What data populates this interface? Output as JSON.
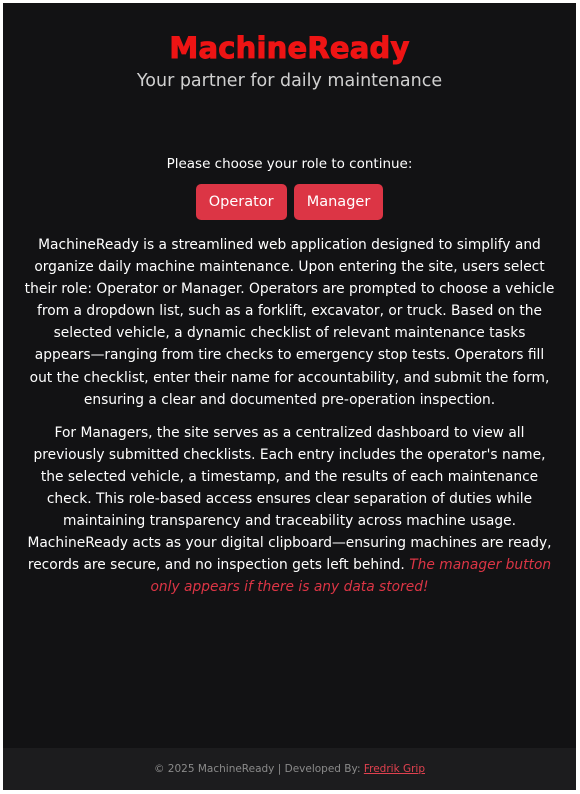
{
  "header": {
    "brand": "MachineReady",
    "tagline": "Your partner for daily maintenance"
  },
  "role_select": {
    "prompt": "Please choose your role to continue:",
    "operator_label": "Operator",
    "manager_label": "Manager"
  },
  "description": {
    "paragraph1": "MachineReady is a streamlined web application designed to simplify and organize daily machine maintenance. Upon entering the site, users select their role: Operator or Manager. Operators are prompted to choose a vehicle from a dropdown list, such as a forklift, excavator, or truck. Based on the selected vehicle, a dynamic checklist of relevant maintenance tasks appears—ranging from tire checks to emergency stop tests. Operators fill out the checklist, enter their name for accountability, and submit the form, ensuring a clear and documented pre-operation inspection.",
    "paragraph2": "For Managers, the site serves as a centralized dashboard to view all previously submitted checklists. Each entry includes the operator's name, the selected vehicle, a timestamp, and the results of each maintenance check. This role-based access ensures clear separation of duties while maintaining transparency and traceability across machine usage. MachineReady acts as your digital clipboard—ensuring machines are ready, records are secure, and no inspection gets left behind.",
    "note": "The manager button only appears if there is any data stored!"
  },
  "footer": {
    "text": "© 2025 MachineReady | Developed By:",
    "author": "Fredrik Grip"
  },
  "colors": {
    "background": "#121214",
    "brand": "#ee1414",
    "button": "#dc3545",
    "note": "#dc3545",
    "footer_bg": "#1c1c1e"
  }
}
